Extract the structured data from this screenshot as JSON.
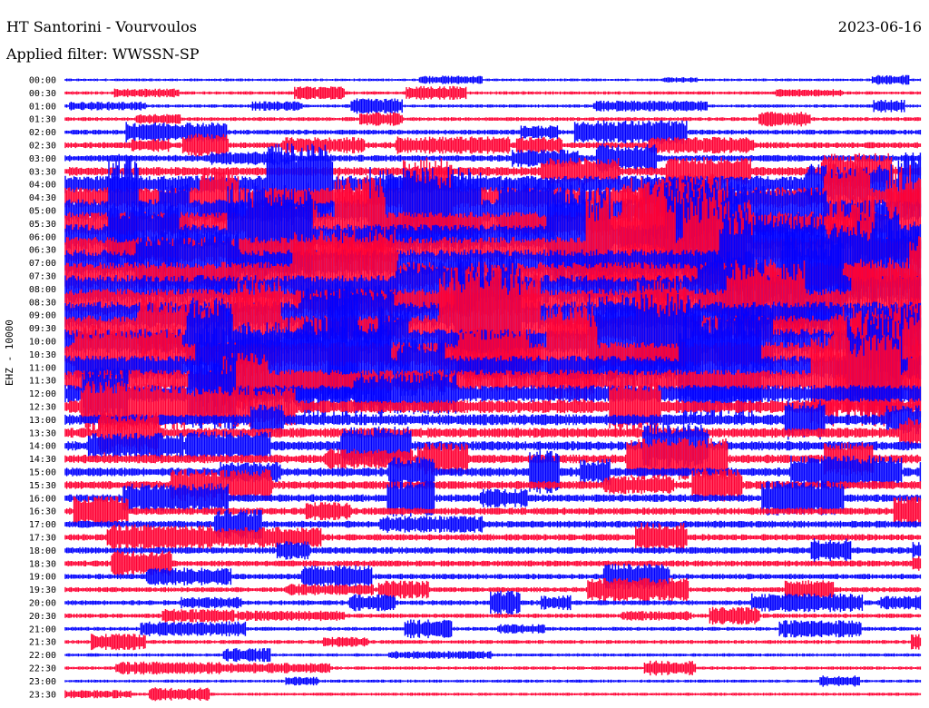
{
  "header": {
    "station": "HT Santorini - Vourvoulos",
    "date": "2023-06-16",
    "filter": "Applied filter: WWSSN-SP"
  },
  "chart_data": {
    "type": "line",
    "title": "HT Santorini - Vourvoulos",
    "subtitle": "Applied filter: WWSSN-SP",
    "ylabel": "EHZ - 10000",
    "xlabel": "",
    "grid": false,
    "colors": [
      "#0000ff",
      "#ff0033"
    ],
    "rows": [
      "00:00",
      "00:30",
      "01:00",
      "01:30",
      "02:00",
      "02:30",
      "03:00",
      "03:30",
      "04:00",
      "04:30",
      "05:00",
      "05:30",
      "06:00",
      "06:30",
      "07:00",
      "07:30",
      "08:00",
      "08:30",
      "09:00",
      "09:30",
      "10:00",
      "10:30",
      "11:00",
      "11:30",
      "12:00",
      "12:30",
      "13:00",
      "13:30",
      "14:00",
      "14:30",
      "15:00",
      "15:30",
      "16:00",
      "16:30",
      "17:00",
      "17:30",
      "18:00",
      "18:30",
      "19:00",
      "19:30",
      "20:00",
      "20:30",
      "21:00",
      "21:30",
      "22:00",
      "22:30",
      "23:00",
      "23:30"
    ],
    "relative_amplitude": [
      0.25,
      0.3,
      0.3,
      0.35,
      0.45,
      0.55,
      0.6,
      0.8,
      1.6,
      1.9,
      2.1,
      2.2,
      2.3,
      2.4,
      2.5,
      2.6,
      2.6,
      2.5,
      2.5,
      2.4,
      2.3,
      2.3,
      2.2,
      2.0,
      1.6,
      1.2,
      1.0,
      0.9,
      0.85,
      0.8,
      0.8,
      0.75,
      0.7,
      0.65,
      0.65,
      0.6,
      0.6,
      0.55,
      0.5,
      0.45,
      0.45,
      0.4,
      0.35,
      0.35,
      0.3,
      0.3,
      0.28,
      0.28
    ]
  }
}
